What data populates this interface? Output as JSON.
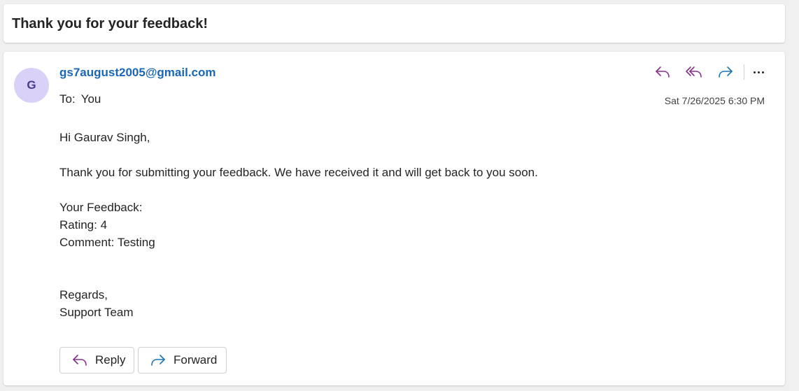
{
  "subject": {
    "title": "Thank you for your feedback!"
  },
  "message": {
    "avatar_initial": "G",
    "sender": "gs7august2005@gmail.com",
    "to_label": "To:",
    "to_value": "You",
    "timestamp": "Sat 7/26/2025 6:30 PM",
    "toolbar_icons": [
      "reply-icon",
      "reply-all-icon",
      "forward-icon",
      "more-options-icon"
    ],
    "body": {
      "greeting": "Hi Gaurav Singh,",
      "line1": "Thank you for submitting your feedback. We have received it and will get back to you soon.",
      "feedback_heading": "Your Feedback:",
      "rating": "Rating: 4",
      "comment": "Comment: Testing",
      "regards": "Regards,",
      "signature": "Support Team"
    },
    "actions": {
      "reply_label": "Reply",
      "forward_label": "Forward"
    }
  },
  "colors": {
    "reply_icon": "#8a2f8f",
    "forward_icon": "#1a75b8",
    "sender_link": "#1a67b8",
    "avatar_bg": "#d9d1f7",
    "avatar_text": "#4b3a8f"
  }
}
